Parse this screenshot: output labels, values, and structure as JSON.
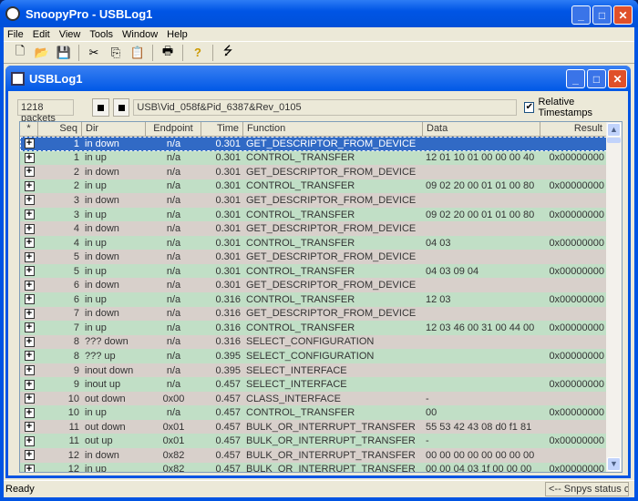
{
  "window": {
    "title": "SnoopyPro - USBLog1"
  },
  "menu": [
    "File",
    "Edit",
    "View",
    "Tools",
    "Window",
    "Help"
  ],
  "toolbar_icons": [
    "new-icon",
    "open-icon",
    "save-icon",
    "cut-icon",
    "copy-icon",
    "paste-icon",
    "print-icon",
    "help-icon",
    "usb-icon"
  ],
  "child": {
    "title": "USBLog1",
    "packets": "1218 packets",
    "device_path": "USB\\Vid_058f&Pid_6387&Rev_0105",
    "relative_timestamps_label": "Relative Timestamps",
    "relative_timestamps_checked": true
  },
  "columns": [
    "*",
    "Seq",
    "Dir",
    "Endpoint",
    "Time",
    "Function",
    "Data",
    "Result"
  ],
  "rows": [
    {
      "seq": "1",
      "dir": "in down",
      "ep": "n/a",
      "time": "0.301",
      "fn": "GET_DESCRIPTOR_FROM_DEVICE",
      "data": "",
      "result": "",
      "selected": true
    },
    {
      "seq": "1",
      "dir": "in up",
      "ep": "n/a",
      "time": "0.301",
      "fn": "CONTROL_TRANSFER",
      "data": "12 01 10 01 00 00 00 40",
      "result": "0x00000000"
    },
    {
      "seq": "2",
      "dir": "in down",
      "ep": "n/a",
      "time": "0.301",
      "fn": "GET_DESCRIPTOR_FROM_DEVICE",
      "data": "",
      "result": ""
    },
    {
      "seq": "2",
      "dir": "in up",
      "ep": "n/a",
      "time": "0.301",
      "fn": "CONTROL_TRANSFER",
      "data": "09 02 20 00 01 01 00 80",
      "result": "0x00000000"
    },
    {
      "seq": "3",
      "dir": "in down",
      "ep": "n/a",
      "time": "0.301",
      "fn": "GET_DESCRIPTOR_FROM_DEVICE",
      "data": "",
      "result": ""
    },
    {
      "seq": "3",
      "dir": "in up",
      "ep": "n/a",
      "time": "0.301",
      "fn": "CONTROL_TRANSFER",
      "data": "09 02 20 00 01 01 00 80",
      "result": "0x00000000"
    },
    {
      "seq": "4",
      "dir": "in down",
      "ep": "n/a",
      "time": "0.301",
      "fn": "GET_DESCRIPTOR_FROM_DEVICE",
      "data": "",
      "result": ""
    },
    {
      "seq": "4",
      "dir": "in up",
      "ep": "n/a",
      "time": "0.301",
      "fn": "CONTROL_TRANSFER",
      "data": "04 03",
      "result": "0x00000000"
    },
    {
      "seq": "5",
      "dir": "in down",
      "ep": "n/a",
      "time": "0.301",
      "fn": "GET_DESCRIPTOR_FROM_DEVICE",
      "data": "",
      "result": ""
    },
    {
      "seq": "5",
      "dir": "in up",
      "ep": "n/a",
      "time": "0.301",
      "fn": "CONTROL_TRANSFER",
      "data": "04 03 09 04",
      "result": "0x00000000"
    },
    {
      "seq": "6",
      "dir": "in down",
      "ep": "n/a",
      "time": "0.301",
      "fn": "GET_DESCRIPTOR_FROM_DEVICE",
      "data": "",
      "result": ""
    },
    {
      "seq": "6",
      "dir": "in up",
      "ep": "n/a",
      "time": "0.316",
      "fn": "CONTROL_TRANSFER",
      "data": "12 03",
      "result": "0x00000000"
    },
    {
      "seq": "7",
      "dir": "in down",
      "ep": "n/a",
      "time": "0.316",
      "fn": "GET_DESCRIPTOR_FROM_DEVICE",
      "data": "",
      "result": ""
    },
    {
      "seq": "7",
      "dir": "in up",
      "ep": "n/a",
      "time": "0.316",
      "fn": "CONTROL_TRANSFER",
      "data": "12 03 46 00 31 00 44 00",
      "result": "0x00000000"
    },
    {
      "seq": "8",
      "dir": "??? down",
      "ep": "n/a",
      "time": "0.316",
      "fn": "SELECT_CONFIGURATION",
      "data": "",
      "result": ""
    },
    {
      "seq": "8",
      "dir": "??? up",
      "ep": "n/a",
      "time": "0.395",
      "fn": "SELECT_CONFIGURATION",
      "data": "",
      "result": "0x00000000"
    },
    {
      "seq": "9",
      "dir": "inout down",
      "ep": "n/a",
      "time": "0.395",
      "fn": "SELECT_INTERFACE",
      "data": "",
      "result": ""
    },
    {
      "seq": "9",
      "dir": "inout up",
      "ep": "n/a",
      "time": "0.457",
      "fn": "SELECT_INTERFACE",
      "data": "",
      "result": "0x00000000"
    },
    {
      "seq": "10",
      "dir": "out down",
      "ep": "0x00",
      "time": "0.457",
      "fn": "CLASS_INTERFACE",
      "data": "-",
      "result": ""
    },
    {
      "seq": "10",
      "dir": "in up",
      "ep": "n/a",
      "time": "0.457",
      "fn": "CONTROL_TRANSFER",
      "data": "00",
      "result": "0x00000000"
    },
    {
      "seq": "11",
      "dir": "out down",
      "ep": "0x01",
      "time": "0.457",
      "fn": "BULK_OR_INTERRUPT_TRANSFER",
      "data": "55 53 42 43 08 d0 f1 81",
      "result": ""
    },
    {
      "seq": "11",
      "dir": "out up",
      "ep": "0x01",
      "time": "0.457",
      "fn": "BULK_OR_INTERRUPT_TRANSFER",
      "data": "-",
      "result": "0x00000000"
    },
    {
      "seq": "12",
      "dir": "in down",
      "ep": "0x82",
      "time": "0.457",
      "fn": "BULK_OR_INTERRUPT_TRANSFER",
      "data": "00 00 00 00 00 00 00 00",
      "result": ""
    },
    {
      "seq": "12",
      "dir": "in up",
      "ep": "0x82",
      "time": "0.457",
      "fn": "BULK_OR_INTERRUPT_TRANSFER",
      "data": "00 00 04 03 1f 00 00 00",
      "result": "0x00000000"
    }
  ],
  "status": {
    "text": "Ready",
    "pane": "<-- Snpys status c"
  },
  "colors": {
    "row_green": "#c1dfc6",
    "row_pink": "#d8d0cb",
    "selection": "#316ac5"
  }
}
